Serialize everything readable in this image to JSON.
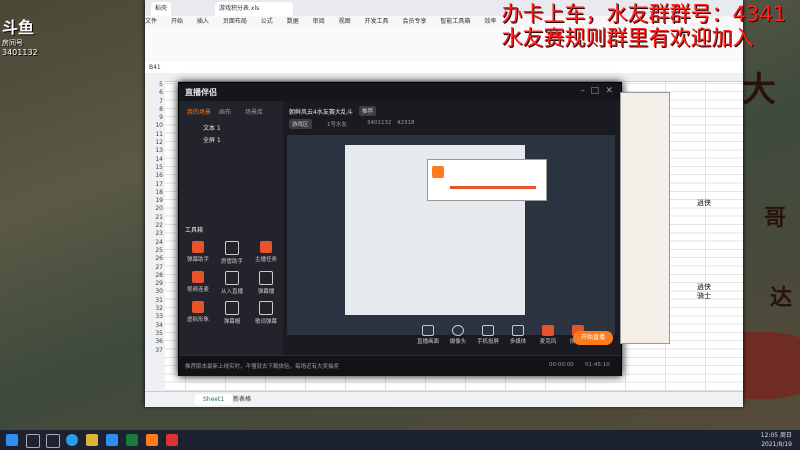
{
  "overlay": {
    "line1": "办卡上车，水友群群号：4341",
    "line2": "水友赛规则群里有欢迎加入"
  },
  "douyu": {
    "logo_text": "斗鱼",
    "streamer": "房间号",
    "room_id": "3401132"
  },
  "map_labels": {
    "big1": "大",
    "big2": "哥",
    "big3": "达"
  },
  "spreadsheet": {
    "tabs": [
      "稻壳",
      "游戏积分表.xls"
    ],
    "menu": [
      "文件",
      "开始",
      "插入",
      "页面布局",
      "公式",
      "数据",
      "审阅",
      "视图",
      "开发工具",
      "会员专享",
      "智能工具箱",
      "效率"
    ],
    "cell_ref": "B41",
    "row_numbers": [
      "5",
      "6",
      "7",
      "8",
      "9",
      "10",
      "11",
      "12",
      "13",
      "14",
      "15",
      "16",
      "17",
      "18",
      "19",
      "20",
      "21",
      "22",
      "23",
      "24",
      "25",
      "26",
      "27",
      "28",
      "29",
      "30",
      "31",
      "32",
      "33",
      "34",
      "35",
      "36",
      "37"
    ],
    "right_cells": [
      "逍侠",
      "逍侠",
      "骑士"
    ],
    "sheet_tabs": [
      "Sheet1",
      "新表格"
    ]
  },
  "app": {
    "title": "直播伴侣",
    "nav_tabs": [
      "我的场景",
      "画布",
      "场景库"
    ],
    "layers": [
      "文本 1",
      "全屏 1"
    ],
    "tools_title": "工具箱",
    "tools": [
      "弹幕助手",
      "房管助手",
      "主播任务",
      "视频连麦",
      "从入直播",
      "弹幕播",
      "虚拟形象",
      "弹幕帽",
      "歌词弹幕"
    ],
    "stream_title": "朝鲜风云4水友赛大乱斗",
    "stream_tag": "推荐",
    "category": "游戏区",
    "host": "1号水友",
    "viewers": "3401132",
    "likes": "42318",
    "controls": [
      "直播画面",
      "摄像头",
      "手机投屏",
      "多媒体",
      "麦克风",
      "扬声器"
    ],
    "live_button": "开始直播",
    "notice": "推荐版本最新上线实时，不懂就去下载体验，每场近有大奖抽奖",
    "timer1": "00:00:00",
    "timer2": "01:45:10"
  },
  "taskbar": {
    "time": "12:05 周日",
    "date": "2021/8/19"
  },
  "colors": {
    "accent": "#ff7a1a",
    "overlay_red": "#ff2020",
    "app_bg": "#1e1f25"
  }
}
